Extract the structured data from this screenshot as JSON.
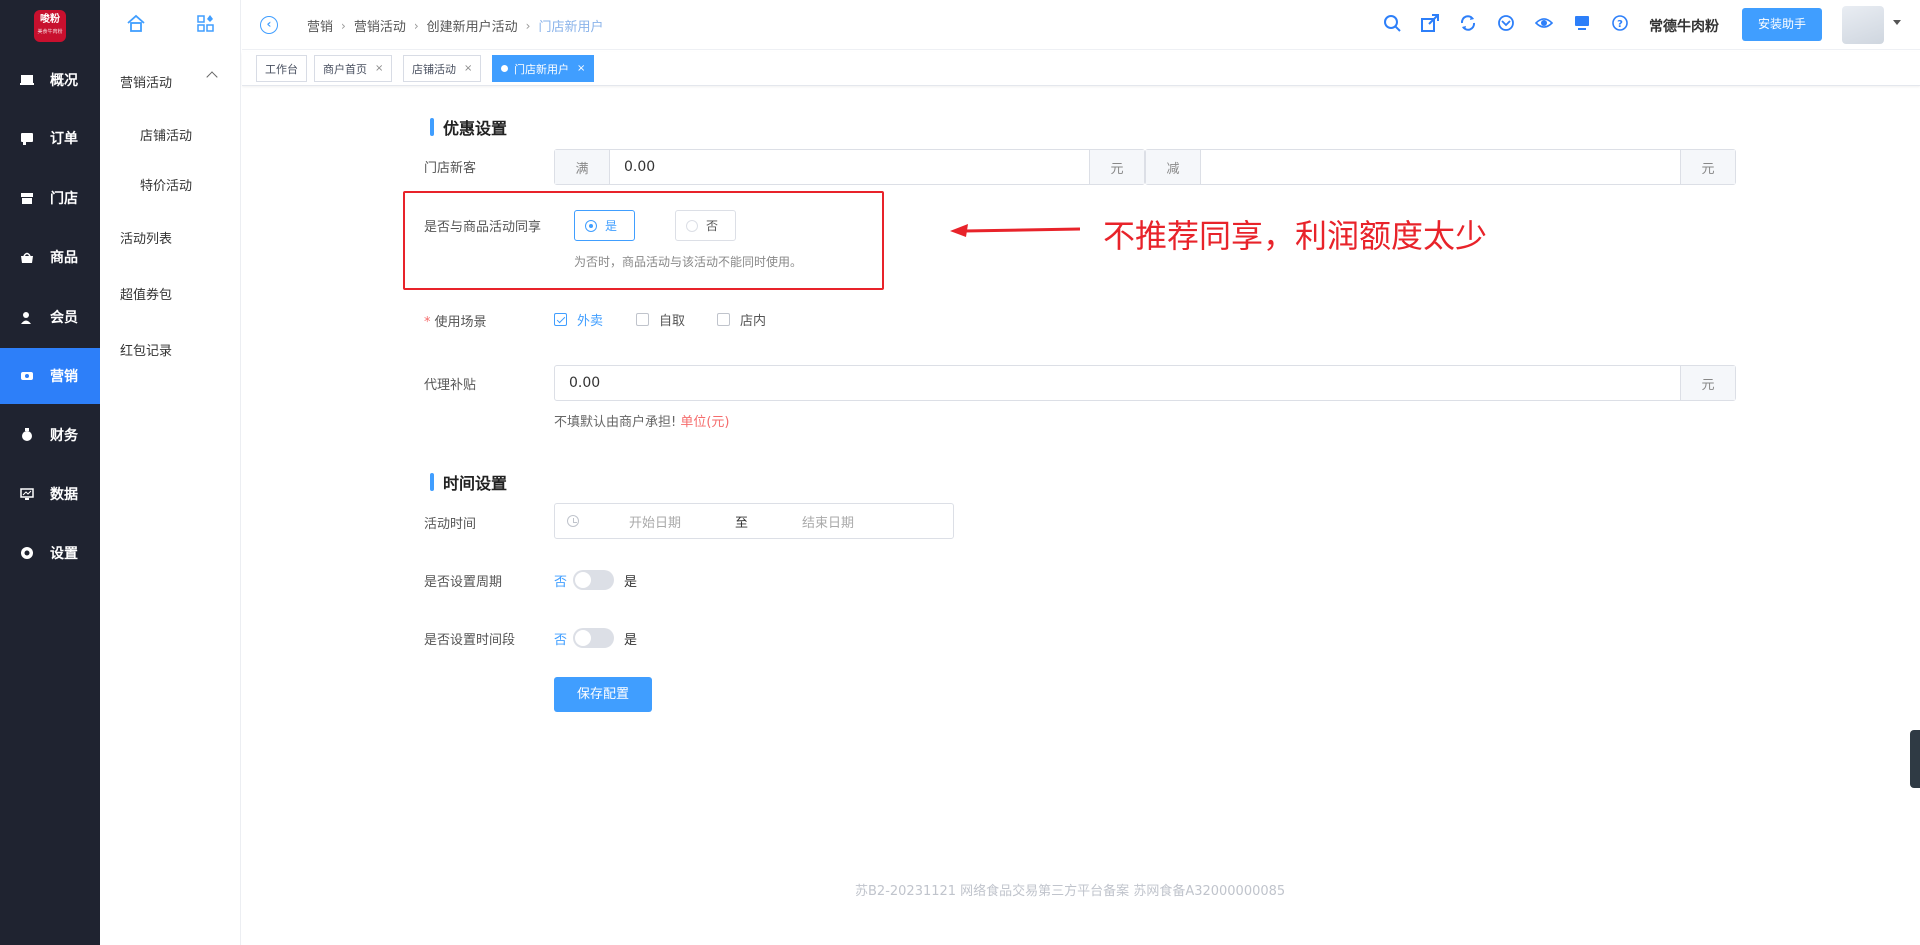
{
  "logo": {
    "name": "唆粉",
    "sub": "美食牛肉粉"
  },
  "sidebar": {
    "items": [
      {
        "label": "概况",
        "icon": "overview-icon"
      },
      {
        "label": "订单",
        "icon": "order-icon"
      },
      {
        "label": "门店",
        "icon": "store-icon"
      },
      {
        "label": "商品",
        "icon": "goods-icon"
      },
      {
        "label": "会员",
        "icon": "member-icon"
      },
      {
        "label": "营销",
        "icon": "marketing-icon",
        "active": true
      },
      {
        "label": "财务",
        "icon": "finance-icon"
      },
      {
        "label": "数据",
        "icon": "data-icon"
      },
      {
        "label": "设置",
        "icon": "settings-icon"
      }
    ]
  },
  "submenu": {
    "group1": "营销活动",
    "children": [
      "店铺活动",
      "特价活动"
    ],
    "others": [
      "活动列表",
      "超值券包",
      "红包记录"
    ]
  },
  "breadcrumb": [
    "营销",
    "营销活动",
    "创建新用户活动",
    "门店新用户"
  ],
  "header": {
    "user_name": "常德牛肉粉",
    "install_label": "安装助手",
    "tools": [
      "search-icon",
      "external-link-icon",
      "refresh-icon",
      "download-icon",
      "eye-icon",
      "monitor-icon",
      "help-icon"
    ]
  },
  "tabs": [
    {
      "label": "工作台",
      "closable": false
    },
    {
      "label": "商户首页",
      "closable": true
    },
    {
      "label": "店铺活动",
      "closable": true
    },
    {
      "label": "门店新用户",
      "closable": true,
      "active": true
    }
  ],
  "discount": {
    "title": "优惠设置",
    "new_customer_label": "门店新客",
    "full_prefix": "满",
    "full_value": "0.00",
    "full_suffix": "元",
    "minus_prefix": "减",
    "minus_value": "",
    "minus_suffix": "元",
    "share_label": "是否与商品活动同享",
    "share_yes": "是",
    "share_no": "否",
    "share_selected": "是",
    "share_hint": "为否时，商品活动与该活动不能同时使用。",
    "scene_label": "使用场景",
    "scenes": [
      {
        "label": "外卖",
        "checked": true
      },
      {
        "label": "自取",
        "checked": false
      },
      {
        "label": "店内",
        "checked": false
      }
    ],
    "subsidy_label": "代理补贴",
    "subsidy_value": "0.00",
    "subsidy_suffix": "元",
    "subsidy_note": "不填默认由商户承担!",
    "subsidy_unit": "单位(元)"
  },
  "annotation": {
    "text": "不推荐同享，利润额度太少",
    "color": "#e8232a"
  },
  "time": {
    "title": "时间设置",
    "activity_time_label": "活动时间",
    "start_placeholder": "开始日期",
    "to": "至",
    "end_placeholder": "结束日期",
    "cycle_label": "是否设置周期",
    "period_label": "是否设置时间段",
    "off": "否",
    "on": "是"
  },
  "save_label": "保存配置",
  "footer": "苏B2-20231121  网络食品交易第三方平台备案 苏网食备A32000000085",
  "colors": {
    "primary": "#409eff",
    "sidebar_bg": "#1f2330",
    "active_nav": "#2d7ff9",
    "danger": "#f56c6c"
  }
}
